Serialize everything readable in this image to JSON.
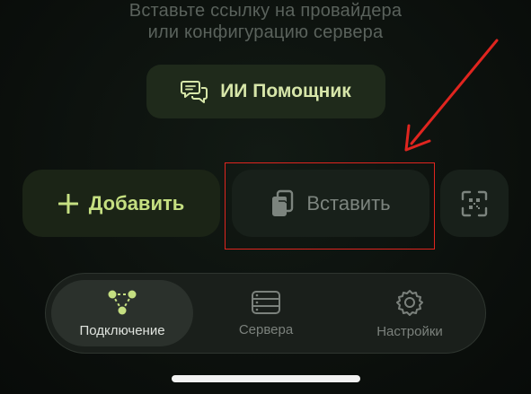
{
  "hint": {
    "line1": "Вставьте ссылку на провайдера",
    "line2": "или конфигурацию сервера"
  },
  "ai_assistant": {
    "label": "ИИ Помощник",
    "icon": "chat-bubbles-icon"
  },
  "actions": {
    "add_label": "Добавить",
    "add_icon": "plus-icon",
    "paste_label": "Вставить",
    "paste_icon": "clipboard-icon",
    "scan_icon": "qr-scan-icon"
  },
  "tabs": [
    {
      "label": "Подключение",
      "icon": "network-nodes-icon",
      "active": true
    },
    {
      "label": "Сервера",
      "icon": "server-stack-icon",
      "active": false
    },
    {
      "label": "Настройки",
      "icon": "gear-icon",
      "active": false
    }
  ],
  "colors": {
    "accent": "#c5df81",
    "annotation": "#e0251f"
  }
}
